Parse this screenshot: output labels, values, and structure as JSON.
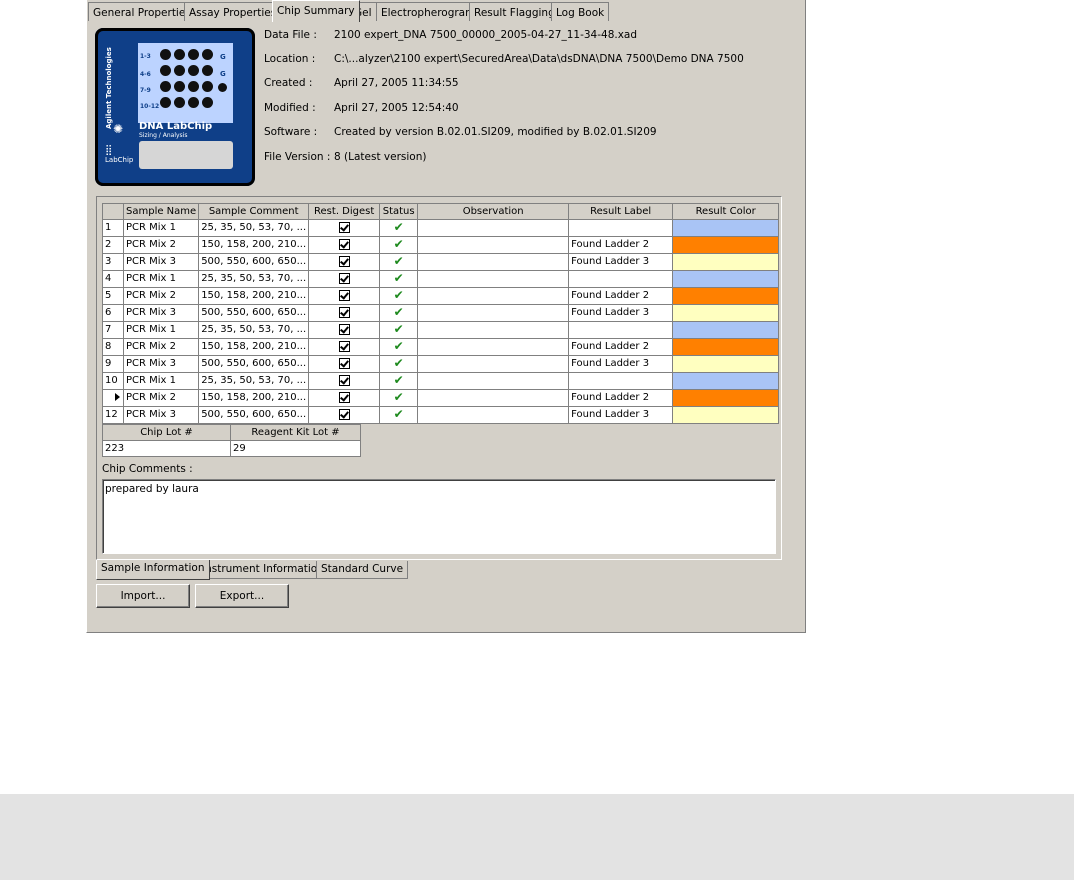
{
  "tabs": [
    {
      "label": "General Properties"
    },
    {
      "label": "Assay Properties"
    },
    {
      "label": "Chip Summary"
    },
    {
      "label": "Gel"
    },
    {
      "label": "Electropherogram"
    },
    {
      "label": "Result Flagging"
    },
    {
      "label": "Log Book"
    }
  ],
  "active_tab": "Chip Summary",
  "chip_image": {
    "brand": "Agilent Technologies",
    "product": "DNA LabChip",
    "subtitle": "Sizing / Analysis",
    "side_logo": "LabChip",
    "row_labels": [
      "1-3",
      "4-6",
      "7-9",
      "10-12"
    ],
    "right_labels": [
      "G",
      "G"
    ]
  },
  "file_info": {
    "data_file_label": "Data File :",
    "data_file": "2100 expert_DNA 7500_00000_2005-04-27_11-34-48.xad",
    "location_label": "Location :",
    "location": "C:\\...alyzer\\2100 expert\\SecuredArea\\Data\\dsDNA\\DNA 7500\\Demo DNA 7500",
    "created_label": "Created :",
    "created": "April 27, 2005 11:34:55",
    "modified_label": "Modified :",
    "modified": "April 27, 2005 12:54:40",
    "software_label": "Software :",
    "software": "Created by version B.02.01.SI209, modified by B.02.01.SI209",
    "file_version_label": "File Version :",
    "file_version": "8 (Latest version)"
  },
  "sample_table": {
    "headers": [
      "",
      "Sample Name",
      "Sample Comment",
      "Rest. Digest",
      "Status",
      "Observation",
      "Result Label",
      "Result Color"
    ],
    "rows": [
      {
        "num": "1",
        "name": "PCR Mix 1",
        "comment": "25, 35, 50, 53, 70, ...",
        "label": "",
        "color": "#a9c4f5"
      },
      {
        "num": "2",
        "name": "PCR Mix 2",
        "comment": "150, 158, 200, 210...",
        "label": "Found Ladder 2",
        "color": "#ff8000"
      },
      {
        "num": "3",
        "name": "PCR Mix 3",
        "comment": "500, 550, 600, 650...",
        "label": "Found Ladder 3",
        "color": "#ffffc0"
      },
      {
        "num": "4",
        "name": "PCR Mix 1",
        "comment": "25, 35, 50, 53, 70, ...",
        "label": "",
        "color": "#a9c4f5"
      },
      {
        "num": "5",
        "name": "PCR Mix 2",
        "comment": "150, 158, 200, 210...",
        "label": "Found Ladder 2",
        "color": "#ff8000"
      },
      {
        "num": "6",
        "name": "PCR Mix 3",
        "comment": "500, 550, 600, 650...",
        "label": "Found Ladder 3",
        "color": "#ffffc0"
      },
      {
        "num": "7",
        "name": "PCR Mix 1",
        "comment": "25, 35, 50, 53, 70, ...",
        "label": "",
        "color": "#a9c4f5"
      },
      {
        "num": "8",
        "name": "PCR Mix 2",
        "comment": "150, 158, 200, 210...",
        "label": "Found Ladder 2",
        "color": "#ff8000"
      },
      {
        "num": "9",
        "name": "PCR Mix 3",
        "comment": "500, 550, 600, 650...",
        "label": "Found Ladder 3",
        "color": "#ffffc0"
      },
      {
        "num": "10",
        "name": "PCR Mix 1",
        "comment": "25, 35, 50, 53, 70, ...",
        "label": "",
        "color": "#a9c4f5"
      },
      {
        "num": "",
        "name": "PCR Mix 2",
        "comment": "150, 158, 200, 210...",
        "label": "Found Ladder 2",
        "color": "#ff8000",
        "current": true
      },
      {
        "num": "12",
        "name": "PCR Mix 3",
        "comment": "500, 550, 600, 650...",
        "label": "Found Ladder 3",
        "color": "#ffffc0"
      }
    ]
  },
  "lots": {
    "chip_lot_header": "Chip Lot #",
    "reagent_lot_header": "Reagent Kit Lot #",
    "chip_lot": "223",
    "reagent_lot": "29"
  },
  "comments": {
    "label": "Chip Comments :",
    "text": "prepared by laura"
  },
  "bottom_tabs": [
    {
      "label": "Sample Information"
    },
    {
      "label": "Instrument Information"
    },
    {
      "label": "Standard Curve"
    }
  ],
  "buttons": {
    "import": "Import...",
    "export": "Export..."
  }
}
